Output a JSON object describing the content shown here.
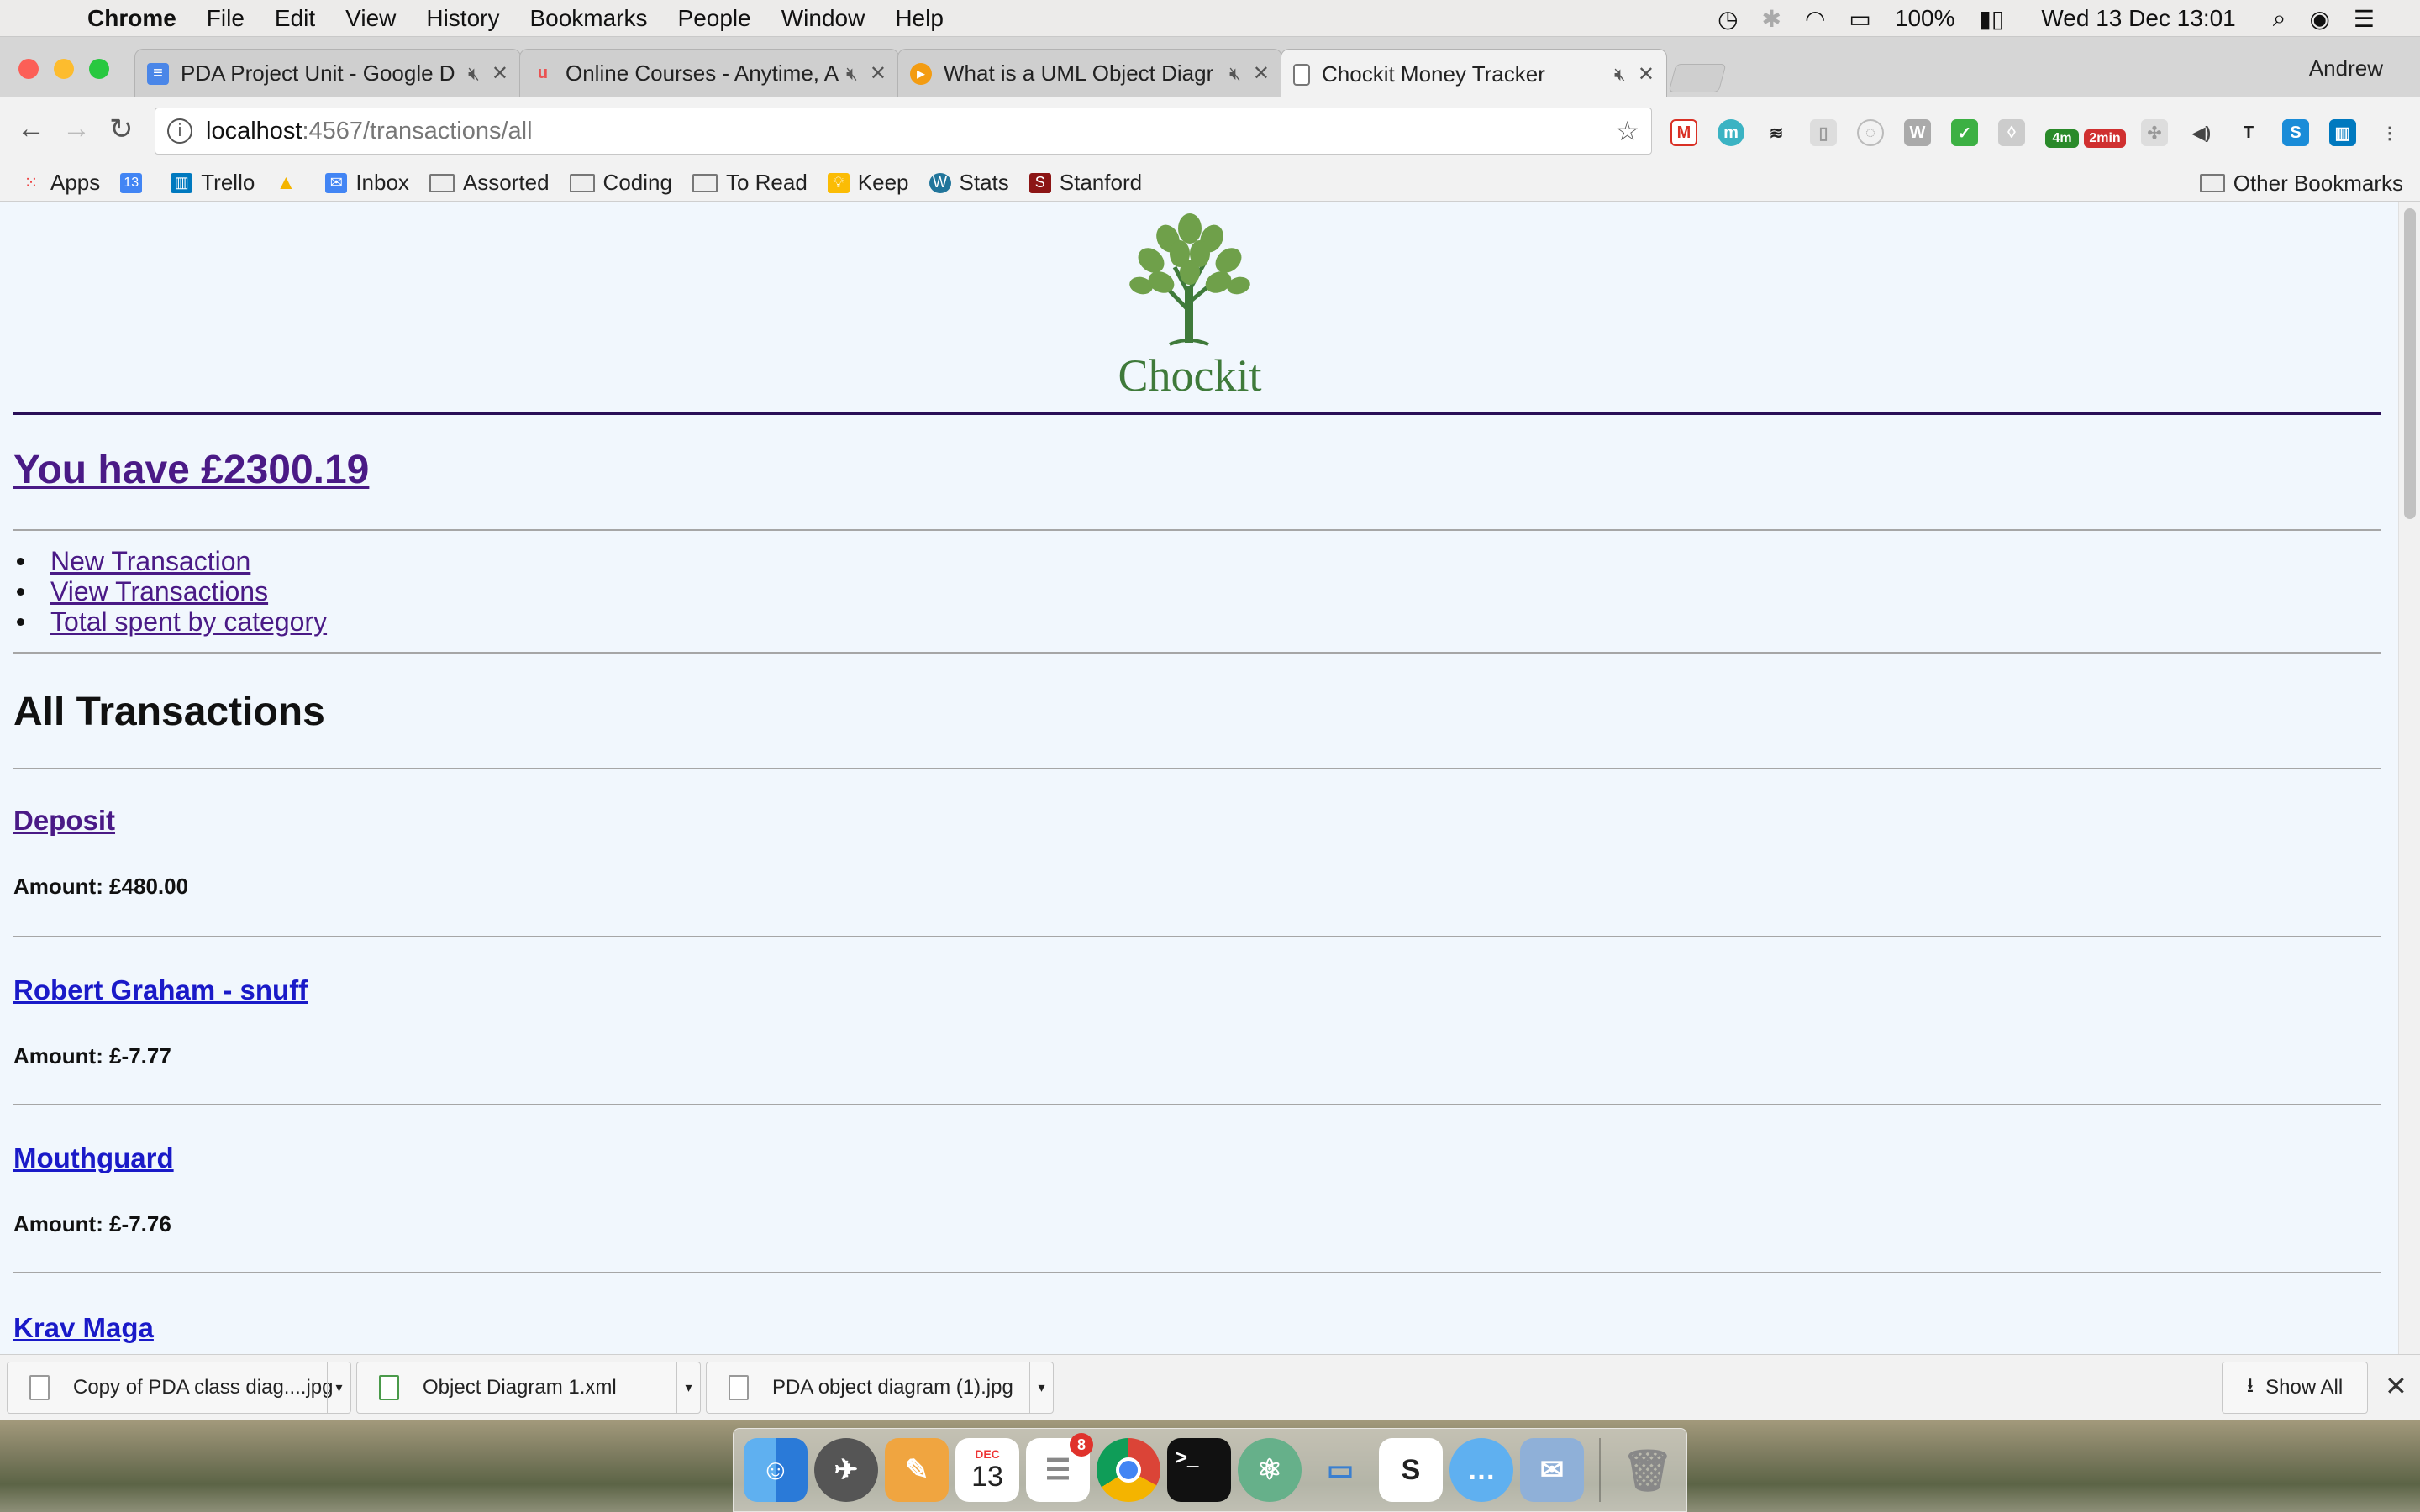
{
  "menubar": {
    "app_name": "Chrome",
    "items": [
      "File",
      "Edit",
      "View",
      "History",
      "Bookmarks",
      "People",
      "Window",
      "Help"
    ],
    "battery": "100%",
    "clock": "Wed 13 Dec  13:01"
  },
  "browser": {
    "profile": "Andrew",
    "tabs": [
      {
        "title": "PDA Project Unit - Google D",
        "icon": "google-docs-icon"
      },
      {
        "title": "Online Courses - Anytime, A",
        "icon": "udemy-icon"
      },
      {
        "title": "What is a UML Object Diagr",
        "icon": "visual-paradigm-icon"
      },
      {
        "title": "Chockit Money Tracker",
        "icon": "document-icon"
      }
    ],
    "url_host": "localhost",
    "url_path": ":4567/transactions/all",
    "ext_badges": {
      "timer1": "4m",
      "timer2": "2min"
    },
    "bookmarks": [
      "Apps",
      "13",
      "Trello",
      "Inbox",
      "Assorted",
      "Coding",
      "To Read",
      "Keep",
      "Stats",
      "Stanford"
    ],
    "other_bookmarks": "Other Bookmarks"
  },
  "page": {
    "logo_text": "Chockit",
    "balance": "You have £2300.19",
    "nav": [
      "New Transaction",
      "View Transactions",
      "Total spent by category"
    ],
    "section_title": "All Transactions",
    "transactions": [
      {
        "name": "Deposit",
        "amount": "Amount: £480.00"
      },
      {
        "name": "Robert Graham - snuff",
        "amount": "Amount: £-7.77"
      },
      {
        "name": "Mouthguard",
        "amount": "Amount: £-7.76"
      },
      {
        "name": "Krav Maga",
        "amount": ""
      }
    ]
  },
  "downloads": {
    "items": [
      "Copy of PDA class diag....jpg",
      "Object Diagram 1.xml",
      "PDA object diagram (1).jpg"
    ],
    "show_all": "Show All"
  },
  "dock": {
    "calendar_month": "DEC",
    "calendar_day": "13",
    "reminders_badge": "8"
  },
  "colors": {
    "page_bg": "#f1f7fd",
    "visited_link": "#4a1a86",
    "link": "#1a1ac8",
    "header_rule": "#2a0f57"
  }
}
